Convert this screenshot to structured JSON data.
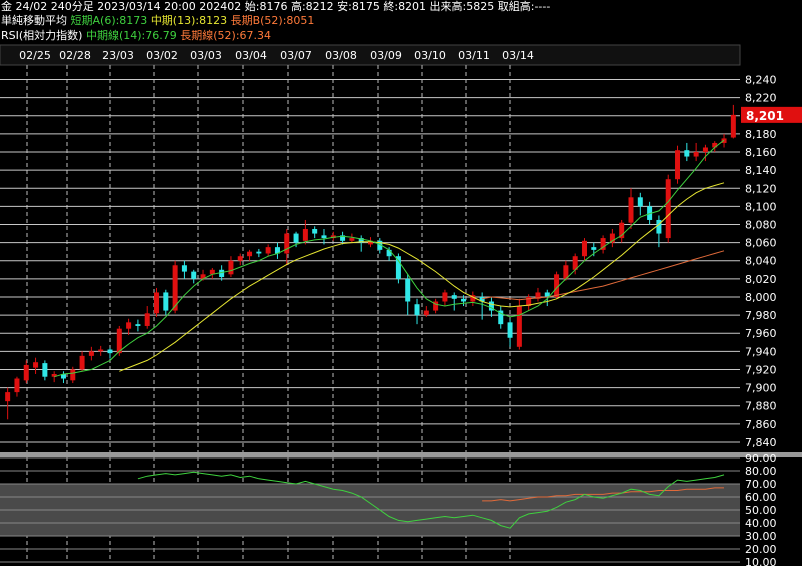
{
  "header": {
    "line1": "金 24/02 240分足 2023/03/14 20:00 202402 始:8176 高:8212 安:8175 終:8201 出来高:5825 取組高:----",
    "sma_label": "単純移動平均",
    "sma_short": "短期A(6):8173",
    "sma_mid": "中期(13):8123",
    "sma_long": "長期B(52):8051",
    "rsi_label": "RSI(相対力指数)",
    "rsi_mid": "中期線(14):76.79",
    "rsi_long": "長期線(52):67.34"
  },
  "colors": {
    "up": "#e01010",
    "down": "#30e8e8",
    "sma_short": "#3fd13f",
    "sma_mid": "#e6e632",
    "sma_long": "#e06a3a",
    "grid": "#c8c8c8",
    "price_tag": "#e01010"
  },
  "chart_data": [
    {
      "type": "candlestick",
      "x_tick_labels": [
        "02/25",
        "02/28",
        "23/03",
        "03/02",
        "03/03",
        "03/04",
        "03/07",
        "03/08",
        "03/09",
        "03/10",
        "03/11",
        "03/14"
      ],
      "y_ticks": [
        7840,
        7860,
        7880,
        7900,
        7920,
        7940,
        7960,
        7980,
        8000,
        8020,
        8040,
        8060,
        8080,
        8100,
        8120,
        8140,
        8160,
        8180,
        8200,
        8220,
        8240
      ],
      "ylim": [
        7830,
        8245
      ],
      "last_price_label": "8,201",
      "last_price": 8201,
      "candles": [
        [
          7885,
          7895,
          7865,
          7900
        ],
        [
          7895,
          7910,
          7890,
          7912
        ],
        [
          7908,
          7925,
          7905,
          7930
        ],
        [
          7922,
          7928,
          7915,
          7933
        ],
        [
          7927,
          7912,
          7908,
          7930
        ],
        [
          7912,
          7915,
          7906,
          7918
        ],
        [
          7915,
          7910,
          7905,
          7918
        ],
        [
          7908,
          7920,
          7905,
          7923
        ],
        [
          7920,
          7935,
          7918,
          7940
        ],
        [
          7935,
          7940,
          7930,
          7945
        ],
        [
          7940,
          7942,
          7935,
          7946
        ],
        [
          7942,
          7938,
          7932,
          7944
        ],
        [
          7938,
          7965,
          7935,
          7968
        ],
        [
          7965,
          7972,
          7958,
          7976
        ],
        [
          7970,
          7968,
          7962,
          7975
        ],
        [
          7968,
          7982,
          7965,
          7990
        ],
        [
          7982,
          8005,
          7978,
          8010
        ],
        [
          8005,
          7985,
          7980,
          8008
        ],
        [
          7985,
          8035,
          7982,
          8040
        ],
        [
          8035,
          8028,
          8020,
          8040
        ],
        [
          8028,
          8020,
          8015,
          8030
        ],
        [
          8020,
          8025,
          8018,
          8030
        ],
        [
          8025,
          8030,
          8020,
          8032
        ],
        [
          8030,
          8022,
          8018,
          8035
        ],
        [
          8025,
          8040,
          8022,
          8045
        ],
        [
          8040,
          8045,
          8035,
          8048
        ],
        [
          8045,
          8050,
          8040,
          8052
        ],
        [
          8050,
          8048,
          8044,
          8053
        ],
        [
          8048,
          8055,
          8045,
          8058
        ],
        [
          8055,
          8048,
          8042,
          8060
        ],
        [
          8048,
          8070,
          8035,
          8075
        ],
        [
          8070,
          8060,
          8055,
          8072
        ],
        [
          8062,
          8075,
          8058,
          8085
        ],
        [
          8075,
          8070,
          8065,
          8078
        ],
        [
          8068,
          8065,
          8058,
          8075
        ],
        [
          8065,
          8068,
          8062,
          8072
        ],
        [
          8068,
          8062,
          8058,
          8072
        ],
        [
          8062,
          8065,
          8060,
          8070
        ],
        [
          8065,
          8060,
          8050,
          8068
        ],
        [
          8058,
          8062,
          8055,
          8066
        ],
        [
          8062,
          8052,
          8048,
          8065
        ],
        [
          8052,
          8045,
          8040,
          8055
        ],
        [
          8045,
          8020,
          8015,
          8048
        ],
        [
          8020,
          7995,
          7980,
          8025
        ],
        [
          7992,
          7980,
          7970,
          7998
        ],
        [
          7980,
          7985,
          7978,
          7990
        ],
        [
          7985,
          7995,
          7982,
          7998
        ],
        [
          7995,
          8005,
          7990,
          8008
        ],
        [
          8002,
          7998,
          7985,
          8005
        ],
        [
          7998,
          7995,
          7990,
          8002
        ],
        [
          7995,
          8002,
          7990,
          8006
        ],
        [
          8000,
          7995,
          7975,
          8005
        ],
        [
          7995,
          7985,
          7978,
          8000
        ],
        [
          7985,
          7970,
          7965,
          7990
        ],
        [
          7972,
          7955,
          7945,
          7975
        ],
        [
          7945,
          7990,
          7942,
          7998
        ],
        [
          7990,
          8000,
          7985,
          8003
        ],
        [
          7998,
          8005,
          7995,
          8010
        ],
        [
          8005,
          8000,
          7990,
          8008
        ],
        [
          8000,
          8025,
          7998,
          8028
        ],
        [
          8020,
          8035,
          8018,
          8040
        ],
        [
          8030,
          8045,
          8025,
          8048
        ],
        [
          8045,
          8062,
          8040,
          8065
        ],
        [
          8055,
          8052,
          8045,
          8060
        ],
        [
          8052,
          8065,
          8048,
          8068
        ],
        [
          8060,
          8070,
          8055,
          8075
        ],
        [
          8065,
          8082,
          8060,
          8085
        ],
        [
          8082,
          8110,
          8075,
          8120
        ],
        [
          8110,
          8100,
          8090,
          8115
        ],
        [
          8100,
          8085,
          8080,
          8105
        ],
        [
          8085,
          8070,
          8055,
          8090
        ],
        [
          8065,
          8130,
          8060,
          8135
        ],
        [
          8130,
          8162,
          8125,
          8167
        ],
        [
          8162,
          8155,
          8150,
          8170
        ],
        [
          8155,
          8160,
          8150,
          8170
        ],
        [
          8160,
          8165,
          8150,
          8168
        ],
        [
          8165,
          8170,
          8160,
          8172
        ],
        [
          8170,
          8175,
          8165,
          8180
        ],
        [
          8176,
          8201,
          8175,
          8212
        ]
      ],
      "sma_short": [
        null,
        null,
        null,
        null,
        null,
        7912,
        7915,
        7916,
        7918,
        7920,
        7925,
        7930,
        7940,
        7948,
        7955,
        7960,
        7968,
        7978,
        7990,
        8002,
        8012,
        8020,
        8025,
        8027,
        8029,
        8033,
        8037,
        8040,
        8045,
        8048,
        8053,
        8058,
        8061,
        8063,
        8064,
        8066,
        8067,
        8066,
        8064,
        8062,
        8058,
        8052,
        8040,
        8025,
        8010,
        7998,
        7992,
        7990,
        7992,
        7993,
        7994,
        7992,
        7988,
        7982,
        7978,
        7980,
        7985,
        7990,
        7998,
        8010,
        8020,
        8030,
        8040,
        8048,
        8055,
        8062,
        8068,
        8078,
        8088,
        8092,
        8095,
        8105,
        8118,
        8130,
        8142,
        8155,
        8165,
        8173
      ],
      "sma_mid": [
        null,
        null,
        null,
        null,
        null,
        null,
        null,
        null,
        null,
        null,
        null,
        null,
        7918,
        7922,
        7926,
        7930,
        7936,
        7943,
        7950,
        7958,
        7966,
        7974,
        7982,
        7990,
        7998,
        8005,
        8012,
        8018,
        8024,
        8030,
        8036,
        8041,
        8045,
        8049,
        8053,
        8056,
        8059,
        8060,
        8061,
        8061,
        8060,
        8058,
        8054,
        8048,
        8042,
        8035,
        8028,
        8020,
        8012,
        8005,
        8000,
        7995,
        7992,
        7990,
        7989,
        7990,
        7991,
        7993,
        7995,
        7998,
        8003,
        8008,
        8015,
        8022,
        8030,
        8038,
        8046,
        8055,
        8064,
        8072,
        8080,
        8090,
        8100,
        8108,
        8115,
        8120,
        8123,
        8126
      ],
      "sma_long": [
        null,
        null,
        null,
        null,
        null,
        null,
        null,
        null,
        null,
        null,
        null,
        null,
        null,
        null,
        null,
        null,
        null,
        null,
        null,
        null,
        null,
        null,
        null,
        null,
        null,
        null,
        null,
        null,
        null,
        null,
        null,
        null,
        null,
        null,
        null,
        null,
        null,
        null,
        null,
        null,
        null,
        null,
        null,
        null,
        null,
        null,
        null,
        null,
        null,
        null,
        null,
        7998,
        8000,
        7999,
        7998,
        7997,
        7998,
        7999,
        8000,
        8002,
        8004,
        8006,
        8008,
        8010,
        8012,
        8015,
        8018,
        8021,
        8024,
        8027,
        8030,
        8033,
        8036,
        8039,
        8042,
        8045,
        8048,
        8051
      ],
      "rsi_y_ticks": [
        10,
        20,
        30,
        40,
        50,
        60,
        70,
        80,
        90
      ],
      "rsi_ylim": [
        10,
        90
      ],
      "rsi_mid": [
        null,
        null,
        null,
        null,
        null,
        null,
        null,
        null,
        null,
        null,
        null,
        null,
        null,
        null,
        74,
        76,
        77,
        78,
        77,
        78,
        79,
        78,
        77,
        76,
        77,
        75,
        76,
        74,
        73,
        72,
        71,
        70,
        72,
        70,
        68,
        66,
        65,
        63,
        60,
        55,
        50,
        45,
        42,
        41,
        42,
        43,
        44,
        45,
        44,
        45,
        46,
        44,
        42,
        38,
        36,
        44,
        47,
        48,
        49,
        52,
        56,
        58,
        62,
        60,
        59,
        61,
        63,
        66,
        65,
        62,
        61,
        68,
        73,
        72,
        73,
        74,
        75,
        77
      ],
      "rsi_long": [
        null,
        null,
        null,
        null,
        null,
        null,
        null,
        null,
        null,
        null,
        null,
        null,
        null,
        null,
        null,
        null,
        null,
        null,
        null,
        null,
        null,
        null,
        null,
        null,
        null,
        null,
        null,
        null,
        null,
        null,
        null,
        null,
        null,
        null,
        null,
        null,
        null,
        null,
        null,
        null,
        null,
        null,
        null,
        null,
        null,
        null,
        null,
        null,
        null,
        null,
        null,
        57,
        57,
        58,
        57,
        58,
        59,
        60,
        60,
        61,
        61,
        62,
        62,
        62,
        62,
        63,
        63,
        64,
        64,
        64,
        65,
        65,
        65,
        66,
        66,
        66,
        67,
        67
      ]
    }
  ]
}
